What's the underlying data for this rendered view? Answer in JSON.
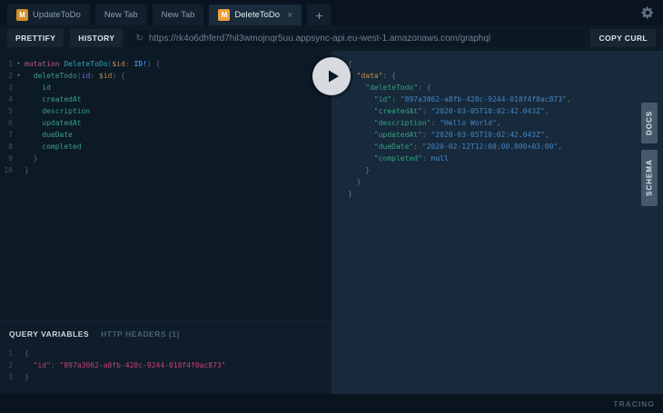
{
  "glyphs": {
    "fold": "▾",
    "close": "×",
    "add_tab": "+",
    "refresh": "↻"
  },
  "colors": {
    "tab_badge": "#d18e2c",
    "tab_badge_active": "#f0a03a",
    "play_button_bg": "#d7dbdf",
    "side_tab_bg": "#47586a",
    "left_pane_bg": "#0c1a26",
    "right_pane_bg": "#17293a"
  },
  "tabs": {
    "items": [
      {
        "label": "UpdateToDo",
        "badge": "M",
        "active": false,
        "closable": false
      },
      {
        "label": "New Tab",
        "badge": "",
        "active": false,
        "closable": false
      },
      {
        "label": "New Tab",
        "badge": "",
        "active": false,
        "closable": false
      },
      {
        "label": "DeleteToDo",
        "badge": "M",
        "active": true,
        "closable": true
      }
    ]
  },
  "toolbar": {
    "prettify": "PRETTIFY",
    "history": "HISTORY",
    "url": "https://rk4o6dhferd7hil3wmojnqr5uu.appsync-api.eu-west-1.amazonaws.com/graphql",
    "copy_curl": "COPY CURL"
  },
  "query_editor": {
    "lines": [
      {
        "num": 1,
        "fold": true,
        "tokens": [
          [
            "kw",
            "mutation"
          ],
          [
            "pl",
            " "
          ],
          [
            "def",
            "DeleteToDo"
          ],
          [
            "p",
            "("
          ],
          [
            "var",
            "$id"
          ],
          [
            "p",
            ": "
          ],
          [
            "type",
            "ID!"
          ],
          [
            "p",
            ") {"
          ]
        ]
      },
      {
        "num": 2,
        "fold": true,
        "tokens": [
          [
            "pl",
            "  "
          ],
          [
            "prop",
            "deleteTodo"
          ],
          [
            "p",
            "("
          ],
          [
            "attr",
            "id"
          ],
          [
            "p",
            ": "
          ],
          [
            "var",
            "$id"
          ],
          [
            "p",
            ") {"
          ]
        ]
      },
      {
        "num": 3,
        "tokens": [
          [
            "pl",
            "    "
          ],
          [
            "prop",
            "id"
          ]
        ]
      },
      {
        "num": 4,
        "tokens": [
          [
            "pl",
            "    "
          ],
          [
            "prop",
            "createdAt"
          ]
        ]
      },
      {
        "num": 5,
        "tokens": [
          [
            "pl",
            "    "
          ],
          [
            "prop",
            "description"
          ]
        ]
      },
      {
        "num": 6,
        "tokens": [
          [
            "pl",
            "    "
          ],
          [
            "prop",
            "updatedAt"
          ]
        ]
      },
      {
        "num": 7,
        "tokens": [
          [
            "pl",
            "    "
          ],
          [
            "prop",
            "dueDate"
          ]
        ]
      },
      {
        "num": 8,
        "tokens": [
          [
            "pl",
            "    "
          ],
          [
            "prop",
            "completed"
          ]
        ]
      },
      {
        "num": 9,
        "tokens": [
          [
            "p",
            "  }"
          ]
        ]
      },
      {
        "num": 10,
        "tokens": [
          [
            "p",
            "}"
          ]
        ]
      }
    ]
  },
  "response_viewer": {
    "lines": [
      {
        "fold": true,
        "tokens": [
          [
            "rp",
            "{"
          ]
        ]
      },
      {
        "fold": true,
        "tokens": [
          [
            "pl",
            "  "
          ],
          [
            "okey",
            "\"data\""
          ],
          [
            "rp",
            ": {"
          ]
        ]
      },
      {
        "fold": true,
        "tokens": [
          [
            "pl",
            "    "
          ],
          [
            "rkey",
            "\"deleteTodo\""
          ],
          [
            "rp",
            ": {"
          ]
        ]
      },
      {
        "tokens": [
          [
            "pl",
            "      "
          ],
          [
            "rkey",
            "\"id\""
          ],
          [
            "rp",
            ": "
          ],
          [
            "str",
            "\"897a3062-a8fb-428c-9244-018f4f0ac873\""
          ],
          [
            "rp",
            ","
          ]
        ]
      },
      {
        "tokens": [
          [
            "pl",
            "      "
          ],
          [
            "rkey",
            "\"createdAt\""
          ],
          [
            "rp",
            ": "
          ],
          [
            "str",
            "\"2020-03-05T10:02:42.043Z\""
          ],
          [
            "rp",
            ","
          ]
        ]
      },
      {
        "tokens": [
          [
            "pl",
            "      "
          ],
          [
            "rkey",
            "\"description\""
          ],
          [
            "rp",
            ": "
          ],
          [
            "str",
            "\"Hello World\""
          ],
          [
            "rp",
            ","
          ]
        ]
      },
      {
        "tokens": [
          [
            "pl",
            "      "
          ],
          [
            "rkey",
            "\"updatedAt\""
          ],
          [
            "rp",
            ": "
          ],
          [
            "str",
            "\"2020-03-05T10:02:42.043Z\""
          ],
          [
            "rp",
            ","
          ]
        ]
      },
      {
        "tokens": [
          [
            "pl",
            "      "
          ],
          [
            "rkey",
            "\"dueDate\""
          ],
          [
            "rp",
            ": "
          ],
          [
            "str",
            "\"2020-02-12T12:00:00.000+03:00\""
          ],
          [
            "rp",
            ","
          ]
        ]
      },
      {
        "tokens": [
          [
            "pl",
            "      "
          ],
          [
            "rkey",
            "\"completed\""
          ],
          [
            "rp",
            ": "
          ],
          [
            "nul",
            "null"
          ]
        ]
      },
      {
        "tokens": [
          [
            "rp",
            "    }"
          ]
        ]
      },
      {
        "tokens": [
          [
            "rp",
            "  }"
          ]
        ]
      },
      {
        "tokens": [
          [
            "rp",
            "}"
          ]
        ]
      }
    ]
  },
  "variables_panel": {
    "query_variables_tab": "QUERY VARIABLES",
    "http_headers_tab": "HTTP HEADERS (1)",
    "lines": [
      {
        "num": 1,
        "tokens": [
          [
            "p",
            "{"
          ]
        ]
      },
      {
        "num": 2,
        "tokens": [
          [
            "pl",
            "  "
          ],
          [
            "vkey",
            "\"id\""
          ],
          [
            "p",
            ": "
          ],
          [
            "vstr",
            "\"897a3062-a8fb-428c-9244-018f4f0ac873\""
          ]
        ]
      },
      {
        "num": 3,
        "tokens": [
          [
            "p",
            "}"
          ]
        ]
      }
    ]
  },
  "side_tabs": {
    "docs": "DOCS",
    "schema": "SCHEMA"
  },
  "footer": {
    "tracing": "TRACING"
  }
}
